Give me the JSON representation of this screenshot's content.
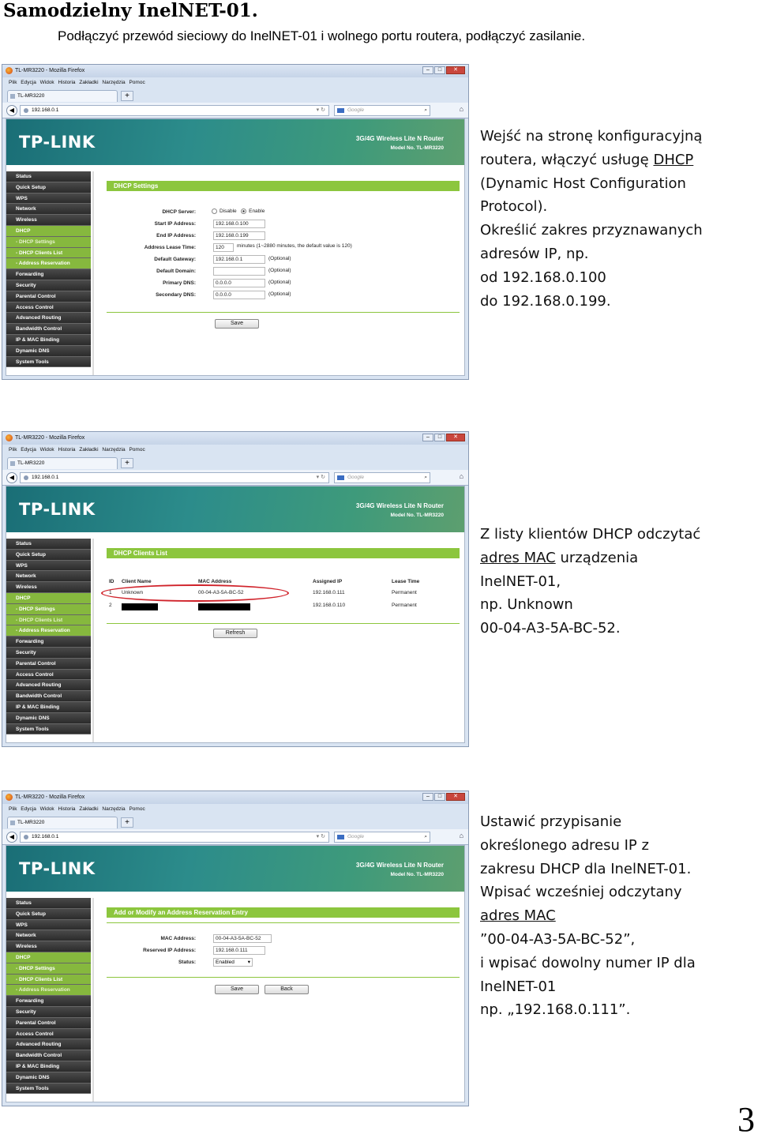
{
  "heading": "Samodzielny InelNET-01.",
  "intro": "Podłączyć przewód sieciowy do InelNET-01 i wolnego portu routera, podłączyć zasilanie.",
  "page_number": "3",
  "browser": {
    "window_title": "TL-MR3220 - Mozilla Firefox",
    "menu": [
      "Plik",
      "Edycja",
      "Widok",
      "Historia",
      "Zakładki",
      "Narzędzia",
      "Pomoc"
    ],
    "tab_title": "TL-MR3220",
    "url": "192.168.0.1",
    "search_placeholder": "Google",
    "logo": "TP-LINK",
    "model_line1": "3G/4G Wireless Lite N Router",
    "model_line2": "Model No. TL-MR3220",
    "nav": [
      "Status",
      "Quick Setup",
      "WPS",
      "Network",
      "Wireless",
      "DHCP",
      "- DHCP Settings",
      "- DHCP Clients List",
      "- Address Reservation",
      "Forwarding",
      "Security",
      "Parental Control",
      "Access Control",
      "Advanced Routing",
      "Bandwidth Control",
      "IP & MAC Binding",
      "Dynamic DNS",
      "System Tools"
    ]
  },
  "step1": {
    "section_title": "DHCP Settings",
    "labels": {
      "server": "DHCP Server:",
      "start": "Start IP Address:",
      "end": "End IP Address:",
      "lease": "Address Lease Time:",
      "gateway": "Default Gateway:",
      "domain": "Default Domain:",
      "dns1": "Primary DNS:",
      "dns2": "Secondary DNS:"
    },
    "disable": "Disable",
    "enable": "Enable",
    "start_ip": "192.168.0.100",
    "end_ip": "192.168.0.199",
    "lease_time": "120",
    "lease_note": "minutes (1~2880 minutes, the default value is 120)",
    "gateway": "192.168.0.1",
    "optional": "(Optional)",
    "dns1": "0.0.0.0",
    "dns2": "0.0.0.0",
    "save": "Save",
    "text": [
      "Wejść na stronę konfiguracyjną",
      "routera, włączyć usługę ",
      "DHCP",
      "(Dynamic Host Configuration",
      "Protocol).",
      "Określić zakres przyznawanych",
      "adresów IP, np.",
      "od 192.168.0.100",
      "do 192.168.0.199."
    ]
  },
  "step2": {
    "section_title": "DHCP Clients List",
    "headers": [
      "ID",
      "Client Name",
      "MAC Address",
      "Assigned IP",
      "Lease Time"
    ],
    "rows": [
      {
        "id": "1",
        "name": "Unknown",
        "mac": "00-04-A3-5A-BC-52",
        "ip": "192.168.0.111",
        "lease": "Permanent"
      },
      {
        "id": "2",
        "name": "",
        "mac": "",
        "ip": "192.168.0.110",
        "lease": "Permanent"
      }
    ],
    "refresh": "Refresh",
    "text": [
      "Z  listy klientów DHCP odczytać",
      "adres MAC",
      " urządzenia",
      "InelNET-01,",
      "np. Unknown",
      "00-04-A3-5A-BC-52."
    ]
  },
  "step3": {
    "section_title": "Add or Modify an Address Reservation Entry",
    "mac_label": "MAC Address:",
    "ip_label": "Reserved IP Address:",
    "status_label": "Status:",
    "mac": "00-04-A3-5A-BC-52",
    "ip": "192.168.0.111",
    "status": "Enabled",
    "save": "Save",
    "back": "Back",
    "text": [
      "Ustawić przypisanie",
      "określonego adresu IP z",
      "zakresu DHCP dla InelNET-01.",
      "Wpisać wcześniej odczytany",
      "adres MAC",
      "”00-04-A3-5A-BC-52”,",
      "i wpisać dowolny numer IP dla",
      "InelNET-01",
      "np. „192.168.0.111”."
    ]
  }
}
